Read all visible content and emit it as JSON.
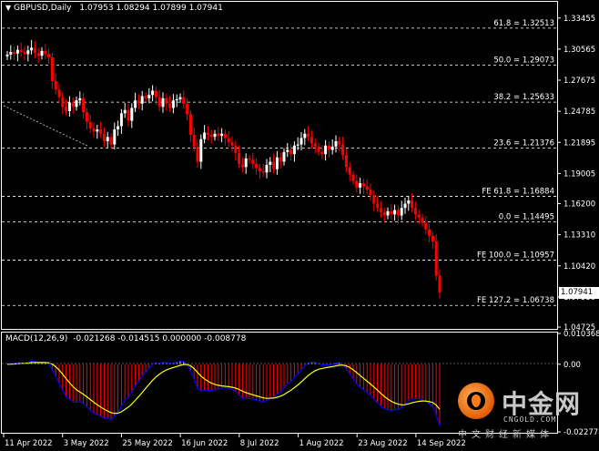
{
  "header": {
    "symbol": "GBPUSD,Daily",
    "ohlc": "1.07953 1.08294 1.07899 1.07941"
  },
  "macd_header": {
    "label": "MACD(12,26,9)",
    "values": "-0.021268 -0.014515 0.000000 -0.008778"
  },
  "price_tag": "1.07941",
  "price_axis": [
    "1.33455",
    "1.30565",
    "1.27675",
    "1.24785",
    "1.21895",
    "1.19005",
    "1.16200",
    "1.13310",
    "1.10420",
    "1.07530",
    "1.04725"
  ],
  "macd_axis": [
    "0.010368",
    "0.00",
    "-0.022774"
  ],
  "date_axis": [
    "11 Apr 2022",
    "3 May 2022",
    "25 May 2022",
    "16 Jun 2022",
    "8 Jul 2022",
    "1 Aug 2022",
    "23 Aug 2022",
    "14 Sep 2022"
  ],
  "fib_levels": [
    {
      "label": "61.8 = 1.32513",
      "value": 1.32513
    },
    {
      "label": "50.0 = 1.29073",
      "value": 1.29073
    },
    {
      "label": "38.2 = 1.25633",
      "value": 1.25633
    },
    {
      "label": "23.6 = 1.21376",
      "value": 1.21376
    },
    {
      "label": "FE 61.8 = 1.16884",
      "value": 1.16884
    },
    {
      "label": "0.0 = 1.14495",
      "value": 1.14495
    },
    {
      "label": "FE 100.0 = 1.10957",
      "value": 1.10957
    },
    {
      "label": "FE 127.2 = 1.06738",
      "value": 1.06738
    }
  ],
  "watermark": {
    "main": "中金网",
    "site": "CNGOLD.COM",
    "sub": "中文财经新媒体"
  },
  "colors": {
    "background": "#000000",
    "bull_candle": "#ffffff",
    "bear_candle": "#ff0000",
    "histogram_positive": "#ffffff",
    "histogram_negative": "#ff0000",
    "macd_line": "#0000ff",
    "signal_line": "#ffff00",
    "level_line": "#ffffff"
  },
  "chart_data": {
    "type": "candlestick",
    "ylim": [
      1.04725,
      1.34875
    ],
    "closes": [
      1.3005,
      1.303,
      1.3015,
      1.305,
      1.303,
      1.301,
      1.3045,
      1.307,
      1.302,
      1.2995,
      1.304,
      1.301,
      1.298,
      1.276,
      1.268,
      1.261,
      1.252,
      1.248,
      1.256,
      1.252,
      1.258,
      1.26,
      1.247,
      1.238,
      1.232,
      1.229,
      1.231,
      1.227,
      1.22,
      1.224,
      1.217,
      1.231,
      1.234,
      1.246,
      1.249,
      1.239,
      1.251,
      1.258,
      1.255,
      1.262,
      1.26,
      1.263,
      1.267,
      1.261,
      1.252,
      1.26,
      1.255,
      1.251,
      1.258,
      1.259,
      1.261,
      1.255,
      1.245,
      1.226,
      1.215,
      1.201,
      1.222,
      1.228,
      1.226,
      1.224,
      1.227,
      1.225,
      1.227,
      1.223,
      1.219,
      1.216,
      1.209,
      1.199,
      1.196,
      1.204,
      1.203,
      1.199,
      1.195,
      1.192,
      1.191,
      1.198,
      1.201,
      1.194,
      1.205,
      1.201,
      1.21,
      1.212,
      1.208,
      1.216,
      1.217,
      1.223,
      1.227,
      1.224,
      1.218,
      1.215,
      1.21,
      1.208,
      1.216,
      1.212,
      1.215,
      1.22,
      1.217,
      1.207,
      1.196,
      1.189,
      1.183,
      1.177,
      1.181,
      1.178,
      1.175,
      1.17,
      1.162,
      1.158,
      1.154,
      1.151,
      1.155,
      1.152,
      1.156,
      1.151,
      1.158,
      1.162,
      1.165,
      1.158,
      1.152,
      1.149,
      1.144,
      1.138,
      1.132,
      1.127,
      1.095,
      1.0794
    ]
  }
}
